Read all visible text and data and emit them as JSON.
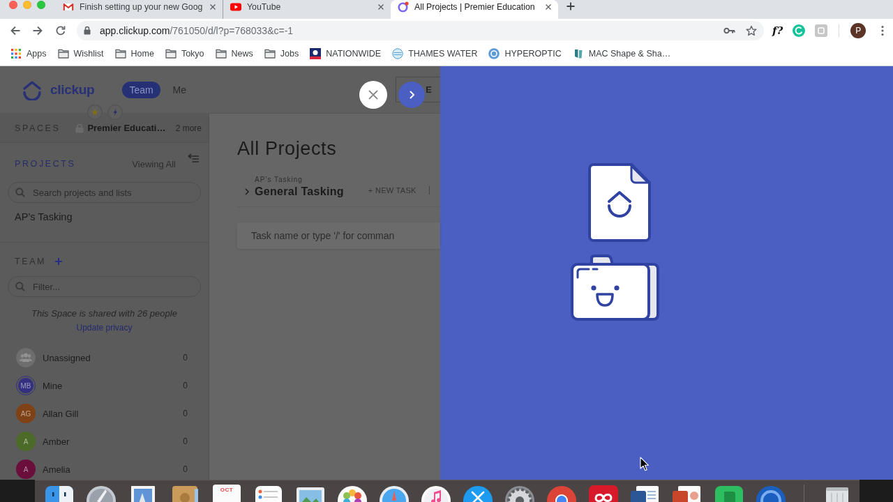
{
  "browser": {
    "tabs": [
      {
        "kind": "mail",
        "title": "Finish setting up your new Goog",
        "selected": false
      },
      {
        "kind": "video",
        "title": "YouTube",
        "selected": false
      },
      {
        "kind": "app",
        "title": "All Projects | Premier Education",
        "selected": true
      }
    ],
    "address": {
      "host": "app.clickup.com",
      "path": "/761050/d/l?p=768033&c=-1"
    },
    "extension_label": "f?",
    "profile_initial": "P",
    "bookmarks": [
      {
        "kind": "apps",
        "label": "Apps"
      },
      {
        "kind": "folder",
        "label": "Wishlist"
      },
      {
        "kind": "folder",
        "label": "Home"
      },
      {
        "kind": "folder",
        "label": "Tokyo"
      },
      {
        "kind": "folder",
        "label": "News"
      },
      {
        "kind": "folder",
        "label": "Jobs"
      },
      {
        "kind": "shield",
        "label": "NATIONWIDE"
      },
      {
        "kind": "globe",
        "label": "THAMES WATER"
      },
      {
        "kind": "badge",
        "label": "HYPEROPTIC"
      },
      {
        "kind": "tube",
        "label": "MAC Shape & Sha…"
      }
    ]
  },
  "app": {
    "logo": "clickup",
    "view_tabs": [
      {
        "label": "Team",
        "selected": true
      },
      {
        "label": "Me",
        "selected": false
      }
    ],
    "header_button": "E",
    "spaces": {
      "label": "SPACES",
      "current": "Premier Educati…",
      "more": "2 more"
    },
    "projects": {
      "label": "PROJECTS",
      "filter": "Viewing All",
      "search_placeholder": "Search projects and lists",
      "items": [
        "AP’s Tasking"
      ]
    },
    "team": {
      "label": "TEAM",
      "filter_placeholder": "Filter...",
      "shared_note": "This Space is shared with 26 people",
      "privacy_link": "Update privacy",
      "members": [
        {
          "kind": "group",
          "name": "Unassigned",
          "count": "0",
          "color": "#6e6e6e",
          "selected": false
        },
        {
          "kind": "person",
          "initials": "MB",
          "name": "Mine",
          "count": "0",
          "color": "#33307f",
          "selected": true
        },
        {
          "kind": "person",
          "initials": "AG",
          "name": "Allan Gill",
          "count": "0",
          "color": "#7f4216",
          "selected": false
        },
        {
          "kind": "person",
          "initials": "A",
          "name": "Amber",
          "count": "0",
          "color": "#4c6b28",
          "selected": false
        },
        {
          "kind": "person",
          "initials": "A",
          "name": "Amelia",
          "count": "0",
          "color": "#6a0f3c",
          "selected": false
        }
      ]
    },
    "main": {
      "title": "All Projects",
      "list_parent": "AP’s Tasking",
      "list_name": "General Tasking",
      "new_task": "+ NEW TASK",
      "task_placeholder": "Task name or type '/' for comman"
    }
  },
  "dock": {
    "calendar_month": "OCT"
  }
}
